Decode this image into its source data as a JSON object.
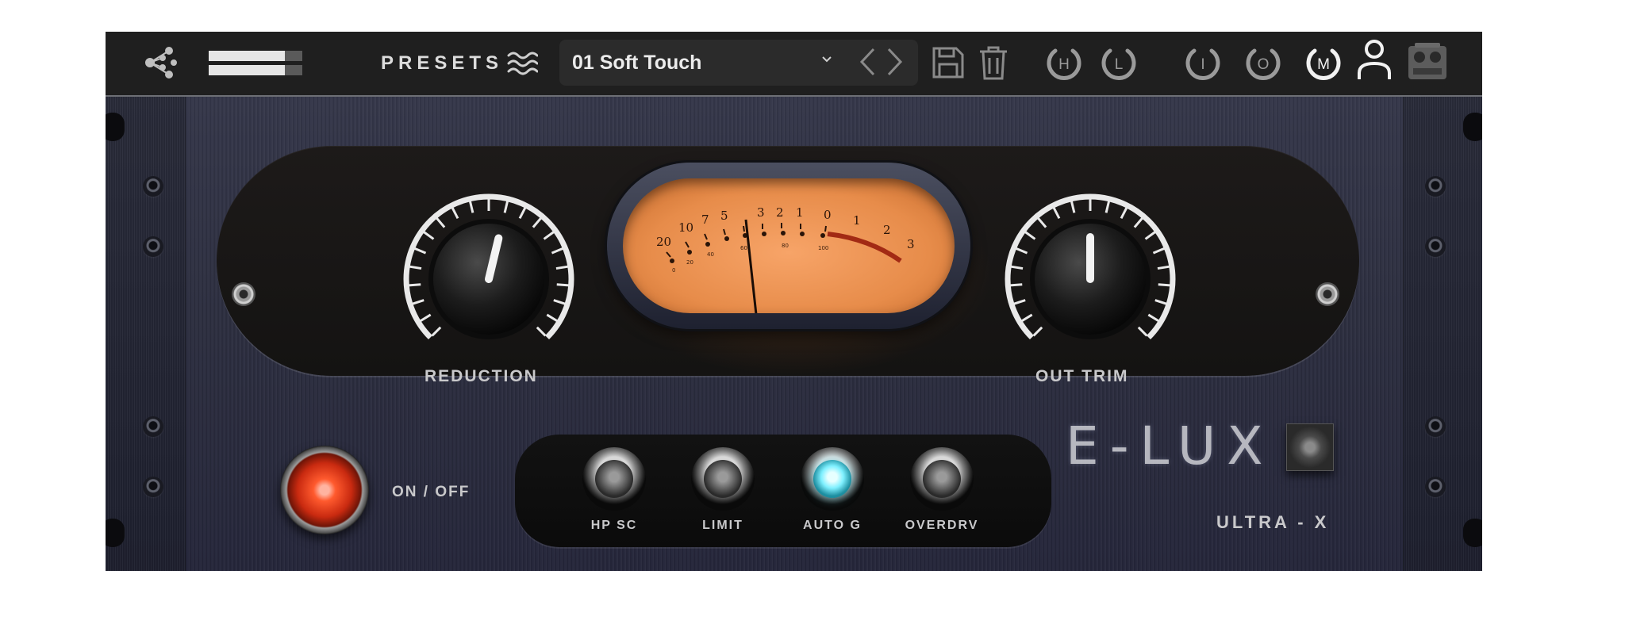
{
  "toolbar": {
    "presets_label": "PRESETS",
    "preset_name": "01 Soft Touch",
    "icons": [
      "share-icon",
      "level-bars-icon",
      "wave-icon",
      "chevron-down-icon",
      "arrow-left-icon",
      "arrow-right-icon",
      "save-icon",
      "trash-icon",
      "user-icon",
      "tape-machine-icon"
    ],
    "circle_buttons": [
      {
        "label": "H",
        "active": false
      },
      {
        "label": "L",
        "active": false
      },
      {
        "label": "I",
        "active": false
      },
      {
        "label": "O",
        "active": false
      },
      {
        "label": "M",
        "active": true
      }
    ]
  },
  "controls": {
    "reduction": {
      "label": "REDUCTION",
      "value": 0.55
    },
    "out_trim": {
      "label": "OUT TRIM",
      "value": 0.5
    }
  },
  "vu_meter": {
    "scale_top": [
      "20",
      "10",
      "7",
      "5",
      "3",
      "2",
      "1",
      "0",
      "1",
      "2",
      "3"
    ],
    "scale_bottom": [
      "0",
      "20",
      "40",
      "60",
      "80",
      "100"
    ],
    "needle_value": "-5"
  },
  "power": {
    "label": "ON / OFF",
    "state": "on"
  },
  "switches": [
    {
      "label": "HP SC",
      "active": false
    },
    {
      "label": "LIMIT",
      "active": false
    },
    {
      "label": "AUTO G",
      "active": true
    },
    {
      "label": "OVERDRV",
      "active": false
    }
  ],
  "brand": {
    "name": "E-LUX",
    "model": "ULTRA - X"
  },
  "colors": {
    "vu_face": "#e78c4a",
    "power_led": "#ff5a2e",
    "active_switch": "#7ff0ff",
    "toolbar_bg": "#1f1f1f"
  }
}
